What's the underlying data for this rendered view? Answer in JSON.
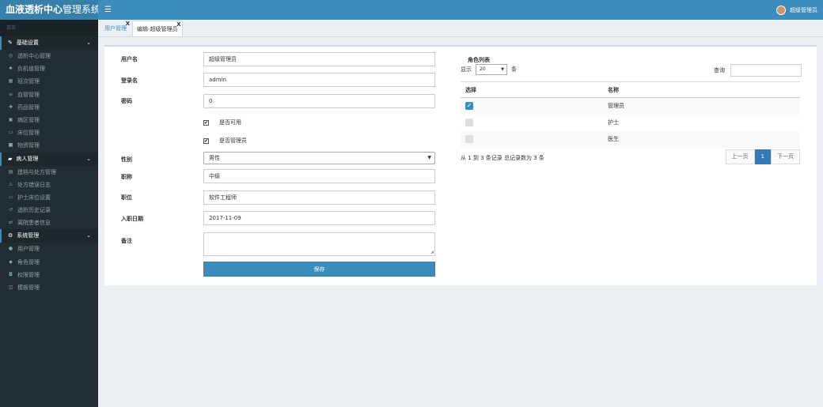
{
  "app": {
    "brand_bold": "血液透析中心",
    "brand_rest": "管理系统",
    "user": "超级管理员"
  },
  "sidebar": {
    "search_hint": "菜单",
    "groups": [
      {
        "label": "基础设置",
        "items": [
          "透析中心管理",
          "负机值管理",
          "班次管理",
          "血管管理",
          "药品管理",
          "病区管理",
          "床位管理",
          "物资管理"
        ]
      },
      {
        "label": "病人管理",
        "items": [
          "建档与处方管理",
          "处方错误日志",
          "护士床位设置",
          "透析历史记录",
          "离院患者信息"
        ]
      },
      {
        "label": "系统管理",
        "items": [
          "用户管理",
          "角色管理",
          "权限管理",
          "模板管理"
        ]
      }
    ]
  },
  "tabs": [
    {
      "label": "用户管理",
      "close": "X"
    },
    {
      "label": "编辑-超级管理员",
      "close": "X"
    }
  ],
  "form": {
    "username_label": "用户名",
    "username": "超级管理员",
    "login_label": "登录名",
    "login": "admin",
    "password_label": "密码",
    "password": "0",
    "enabled_label": "是否可用",
    "enabled_checked": "✔",
    "admin_label": "是否管理员",
    "admin_checked": "✔",
    "gender_label": "性别",
    "gender": "男性",
    "title_label": "职称",
    "title": "中级",
    "position_label": "职位",
    "position": "软件工程师",
    "hire_label": "入职日期",
    "hire": "2017-11-09",
    "remark_label": "备注",
    "save": "保存"
  },
  "roles": {
    "title": "角色列表",
    "show_prefix": "显示",
    "page_len": "20",
    "show_suffix": "条",
    "search_label": "查询",
    "col_select": "选择",
    "col_name": "名称",
    "rows": [
      {
        "name": "管理员",
        "checked": true
      },
      {
        "name": "护士",
        "checked": false
      },
      {
        "name": "医生",
        "checked": false
      }
    ],
    "info": "从 1 到 3 条记录 总记录数为 3 条",
    "prev": "上一页",
    "page": "1",
    "next": "下一页"
  }
}
